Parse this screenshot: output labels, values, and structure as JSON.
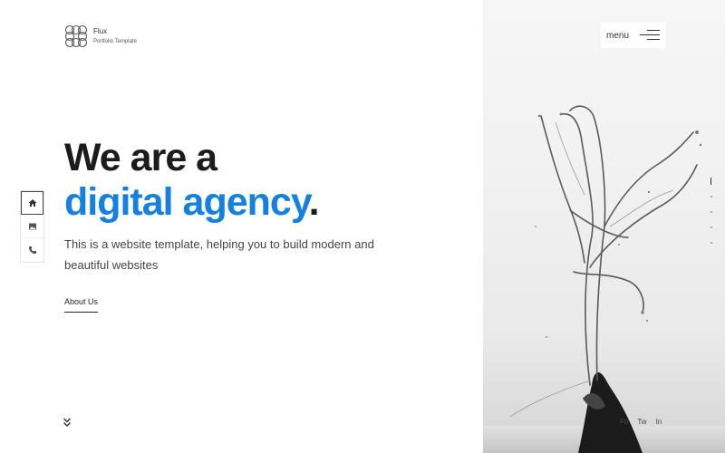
{
  "brand": {
    "name": "Flux",
    "tagline": "Portfolio Template"
  },
  "header": {
    "menu_label": "menu"
  },
  "side_nav": {
    "items": [
      {
        "icon": "home-icon",
        "active": true
      },
      {
        "icon": "image-icon",
        "active": false
      },
      {
        "icon": "phone-icon",
        "active": false
      }
    ]
  },
  "hero": {
    "line1": "We are a",
    "line2": "digital agency",
    "line2_suffix": ".",
    "description": "This is a website template, helping you to build modern and beautiful websites",
    "cta": "About Us"
  },
  "socials": {
    "facebook": "Fb",
    "twitter": "Tw",
    "linkedin": "In"
  },
  "slides": {
    "count": 5,
    "active_index": 0
  },
  "colors": {
    "accent": "#1480e0",
    "text": "#1c1c1c"
  }
}
